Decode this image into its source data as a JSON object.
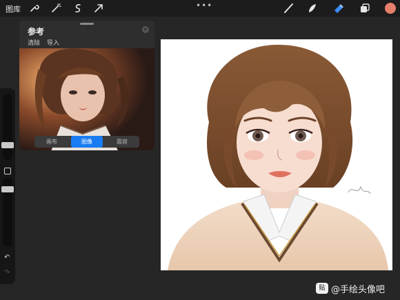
{
  "toolbar": {
    "gallery_label": "图库",
    "more_label": "•••",
    "tools_left": [
      "wrench-icon",
      "magic-wand-icon",
      "selection-s-icon",
      "transform-arrow-icon"
    ],
    "tools_right": [
      "brush-icon",
      "smudge-icon",
      "eraser-icon",
      "layers-icon"
    ],
    "active_tool": "eraser-icon",
    "color": "#e37f6b"
  },
  "reference_panel": {
    "title": "参考",
    "actions": [
      "清除",
      "导入"
    ],
    "close_label": "×",
    "tabs": [
      "画布",
      "图像",
      "面容"
    ],
    "active_tab": "图像"
  },
  "sidebar": {
    "undo_label": "↶",
    "redo_label": "↷"
  },
  "watermark": {
    "logo_text": "贴",
    "text": "@手绘头像吧"
  }
}
